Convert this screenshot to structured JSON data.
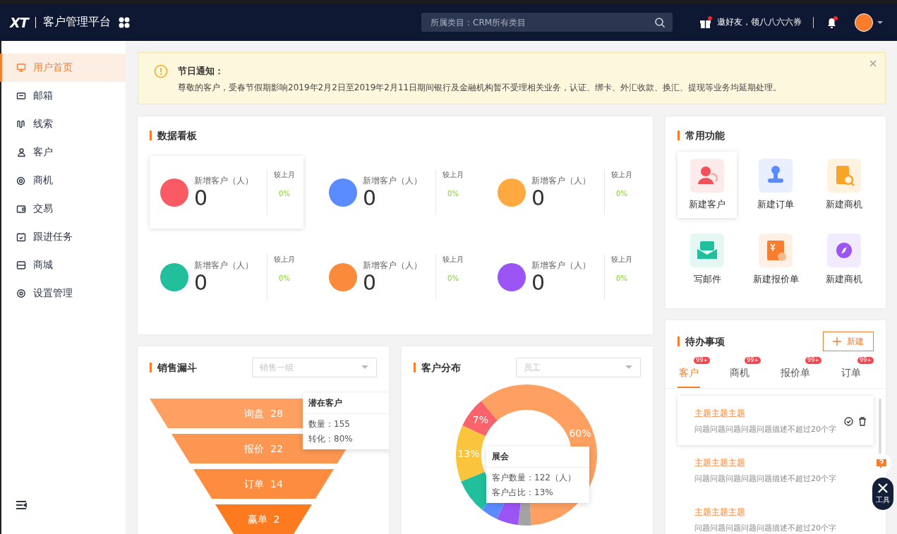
{
  "header": {
    "logo": "XT",
    "title": "客户管理平台",
    "search": {
      "placeholder": "所属类目：CRM所有类目"
    },
    "invite": {
      "label": "邀好友，领八八六六券",
      "unread": true
    },
    "bell": {
      "unread": true
    }
  },
  "sidebar": {
    "items": [
      {
        "label": "用户首页",
        "selected": true
      },
      {
        "label": "邮箱",
        "selected": false
      },
      {
        "label": "线索",
        "selected": false
      },
      {
        "label": "客户",
        "selected": false
      },
      {
        "label": "商机",
        "selected": false
      },
      {
        "label": "交易",
        "selected": false
      },
      {
        "label": "跟进任务",
        "selected": false
      },
      {
        "label": "商城",
        "selected": false
      },
      {
        "label": "设置管理",
        "selected": false
      }
    ]
  },
  "notice": {
    "title": "节日通知：",
    "text": "尊敬的客户，受春节假期影响2019年2月2日至2019年2月11日期间银行及金融机构暂不受理相关业务，认证、绑卡、外汇收款、换汇、提现等业务均延期处理。"
  },
  "dashboard": {
    "title": "数据看板",
    "stats": [
      {
        "color": "#fa5a64",
        "label": "新增客户（人）",
        "value": "0",
        "compare_label": "较上月",
        "change": "0%",
        "highlighted": true
      },
      {
        "color": "#5b8cff",
        "label": "新增客户（人）",
        "value": "0",
        "compare_label": "较上月",
        "change": "0%",
        "highlighted": false
      },
      {
        "color": "#ffa940",
        "label": "新增客户（人）",
        "value": "0",
        "compare_label": "较上月",
        "change": "0%",
        "highlighted": false
      },
      {
        "color": "#22bf9c",
        "label": "新增客户（人）",
        "value": "0",
        "compare_label": "较上月",
        "change": "0%",
        "highlighted": false
      },
      {
        "color": "#fa8a3c",
        "label": "新增客户（人）",
        "value": "0",
        "compare_label": "较上月",
        "change": "0%",
        "highlighted": false
      },
      {
        "color": "#9c55f5",
        "label": "新增客户（人）",
        "value": "0",
        "compare_label": "较上月",
        "change": "0%",
        "highlighted": false
      }
    ]
  },
  "shortcuts": {
    "title": "常用功能",
    "items": [
      {
        "label": "新建客户",
        "highlighted": true
      },
      {
        "label": "新建订单",
        "highlighted": false
      },
      {
        "label": "新建商机",
        "highlighted": false
      },
      {
        "label": "写邮件",
        "highlighted": false
      },
      {
        "label": "新建报价单",
        "highlighted": false
      },
      {
        "label": "新建商机",
        "highlighted": false
      }
    ]
  },
  "funnel": {
    "title": "销售漏斗",
    "select": {
      "placeholder": "销售一组"
    },
    "stages": [
      {
        "label": "询盘",
        "value": "28"
      },
      {
        "label": "报价",
        "value": "22"
      },
      {
        "label": "订单",
        "value": "14"
      },
      {
        "label": "赢单",
        "value": "2"
      }
    ],
    "tooltip": {
      "title": "潜在客户",
      "lines": [
        "数量：155",
        "转化：80%"
      ]
    }
  },
  "distribution": {
    "title": "客户分布",
    "select": {
      "placeholder": "员工"
    },
    "chart_data": {
      "type": "donut",
      "values": [
        60,
        3,
        5,
        4,
        8,
        13,
        7
      ],
      "value_labels": [
        "60%",
        null,
        null,
        null,
        null,
        "13%",
        "7%"
      ]
    },
    "tooltip": {
      "title": "展会",
      "lines": [
        "客户数量：122（人）",
        "客户占比：13%"
      ]
    }
  },
  "todo": {
    "title": "待办事项",
    "new_button": "新建",
    "tabs": [
      {
        "label": "客户",
        "badge": "99+",
        "selected": true
      },
      {
        "label": "商机",
        "badge": "99+",
        "selected": false
      },
      {
        "label": "报价单",
        "badge": "99+",
        "selected": false
      },
      {
        "label": "订单",
        "badge": "99+",
        "selected": false
      }
    ],
    "items": [
      {
        "title": "主题主题主题",
        "description": "问题问题问题问题问题描述不超过20个字",
        "highlighted": true
      },
      {
        "title": "主题主题主题",
        "description": "问题问题问题问题问题描述不超过20个字",
        "highlighted": false
      },
      {
        "title": "主题主题主题",
        "description": "问题问题问题问题问题描述不超过20个字",
        "highlighted": false
      }
    ]
  },
  "float_tools": {
    "tool_label": "工具"
  }
}
